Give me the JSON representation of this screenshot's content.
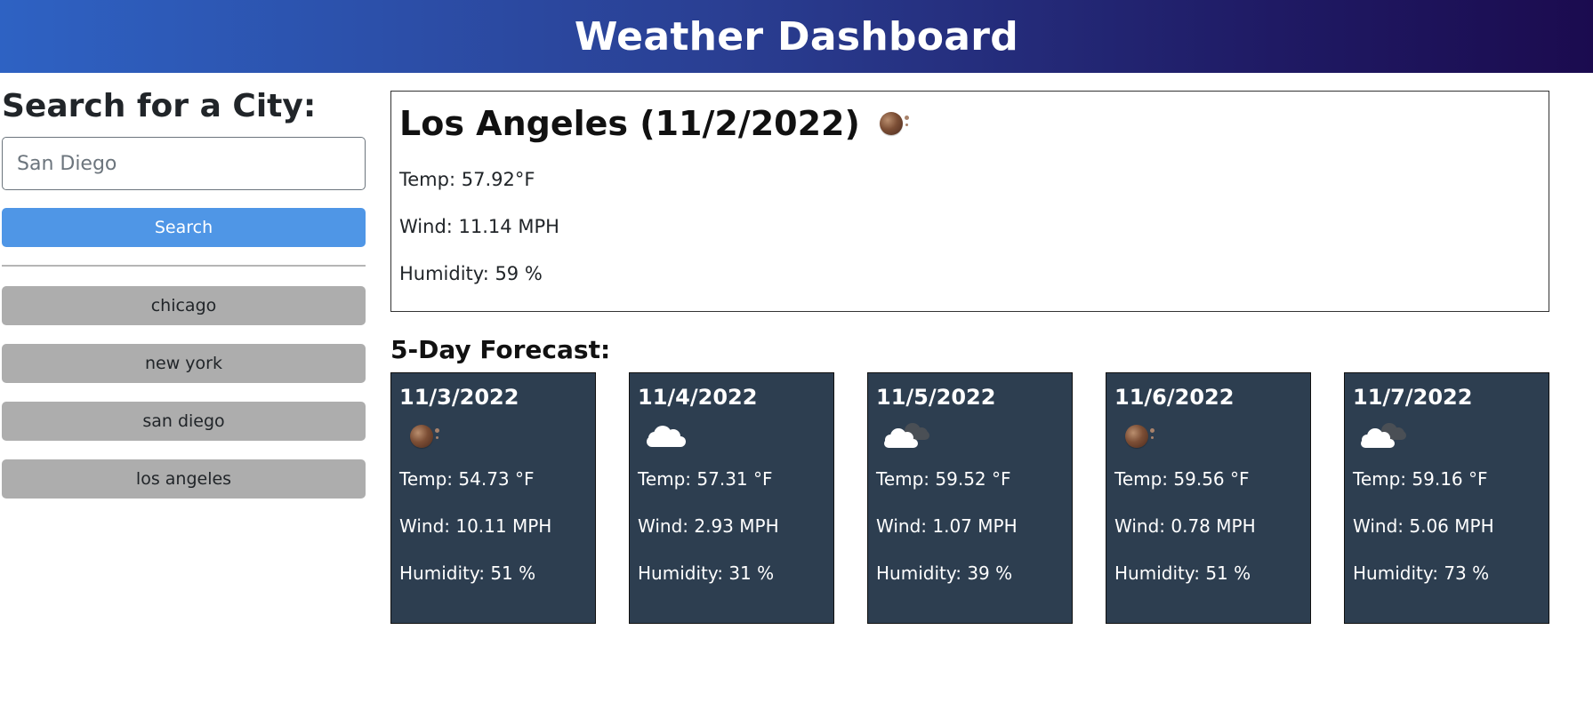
{
  "header": {
    "title": "Weather Dashboard"
  },
  "sidebar": {
    "heading": "Search for a City:",
    "search": {
      "placeholder": "San Diego",
      "value": ""
    },
    "search_button_label": "Search",
    "history": [
      "chicago",
      "new york",
      "san diego",
      "los angeles"
    ]
  },
  "current": {
    "title": "Los Angeles (11/2/2022)",
    "icon": "moon-icon",
    "temp": "Temp: 57.92°F",
    "wind": "Wind: 11.14 MPH",
    "humidity": "Humidity: 59 %"
  },
  "forecast": {
    "heading": "5-Day Forecast:",
    "days": [
      {
        "date": "11/3/2022",
        "icon": "moon-icon",
        "temp": "Temp: 54.73 °F",
        "wind": "Wind: 10.11 MPH",
        "humidity": "Humidity: 51 %"
      },
      {
        "date": "11/4/2022",
        "icon": "cloud-icon",
        "temp": "Temp: 57.31 °F",
        "wind": "Wind: 2.93 MPH",
        "humidity": "Humidity: 31 %"
      },
      {
        "date": "11/5/2022",
        "icon": "broken-clouds-icon",
        "temp": "Temp: 59.52 °F",
        "wind": "Wind: 1.07 MPH",
        "humidity": "Humidity: 39 %"
      },
      {
        "date": "11/6/2022",
        "icon": "moon-icon",
        "temp": "Temp: 59.56 °F",
        "wind": "Wind: 0.78 MPH",
        "humidity": "Humidity: 51 %"
      },
      {
        "date": "11/7/2022",
        "icon": "broken-clouds-icon",
        "temp": "Temp: 59.16 °F",
        "wind": "Wind: 5.06 MPH",
        "humidity": "Humidity: 73 %"
      }
    ]
  },
  "colors": {
    "header_gradient_start": "#2e62c3",
    "header_gradient_end": "#1b0b4f",
    "search_button": "#4f96e6",
    "history_button": "#adadad",
    "forecast_card": "#2d3e50"
  }
}
